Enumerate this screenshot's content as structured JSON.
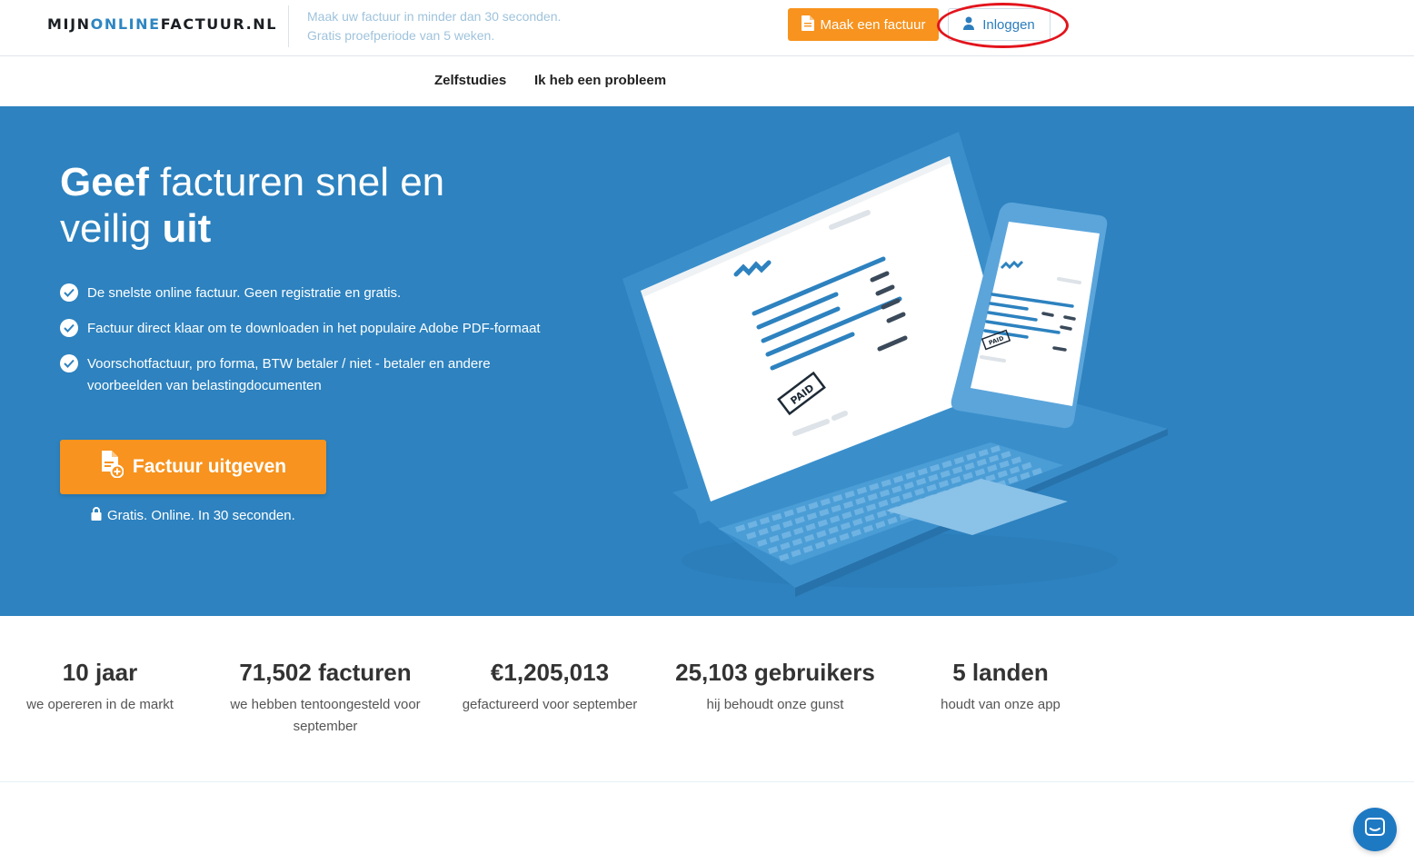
{
  "header": {
    "logo_part1": "MIJN",
    "logo_part2": "ONLINE",
    "logo_part3": "FACTUUR.NL",
    "tagline_line1": "Maak uw factuur in minder dan 30 seconden.",
    "tagline_line2": "Gratis proefperiode van 5 weken.",
    "make_invoice_label": "Maak een factuur",
    "login_label": "Inloggen"
  },
  "subnav": {
    "items": [
      {
        "label": "Zelfstudies"
      },
      {
        "label": "Ik heb een probleem"
      }
    ]
  },
  "hero": {
    "title_bold1": "Geef",
    "title_normal": " facturen snel en veilig ",
    "title_bold2": "uit",
    "features": [
      {
        "text": "De snelste online factuur. Geen registratie en gratis."
      },
      {
        "text": "Factuur direct klaar om te downloaden in het populaire Adobe PDF-formaat"
      },
      {
        "text": "Voorschotfactuur, pro forma, BTW betaler / niet - betaler en andere voorbeelden van belastingdocumenten"
      }
    ],
    "cta_label": "Factuur uitgeven",
    "cta_note": "Gratis. Online. In 30 seconden.",
    "illustration_stamp_laptop": "PAID",
    "illustration_stamp_phone": "PAID"
  },
  "stats": [
    {
      "value": "10 jaar",
      "label": "we opereren in de markt"
    },
    {
      "value": "71,502 facturen",
      "label": "we hebben tentoongesteld voor september"
    },
    {
      "value": "€1,205,013",
      "label": "gefactureerd voor september"
    },
    {
      "value": "25,103 gebruikers",
      "label": "hij behoudt onze gunst"
    },
    {
      "value": "5 landen",
      "label": "houdt van onze app"
    }
  ],
  "colors": {
    "brand_blue": "#2d82bf",
    "accent_orange": "#f7931e",
    "annotation_red": "#e3141c"
  },
  "icons": {
    "make_invoice": "document-icon",
    "login": "user-icon",
    "feature": "check-circle-icon",
    "cta": "document-add-icon",
    "cta_note": "lock-icon",
    "chat": "chat-icon"
  }
}
